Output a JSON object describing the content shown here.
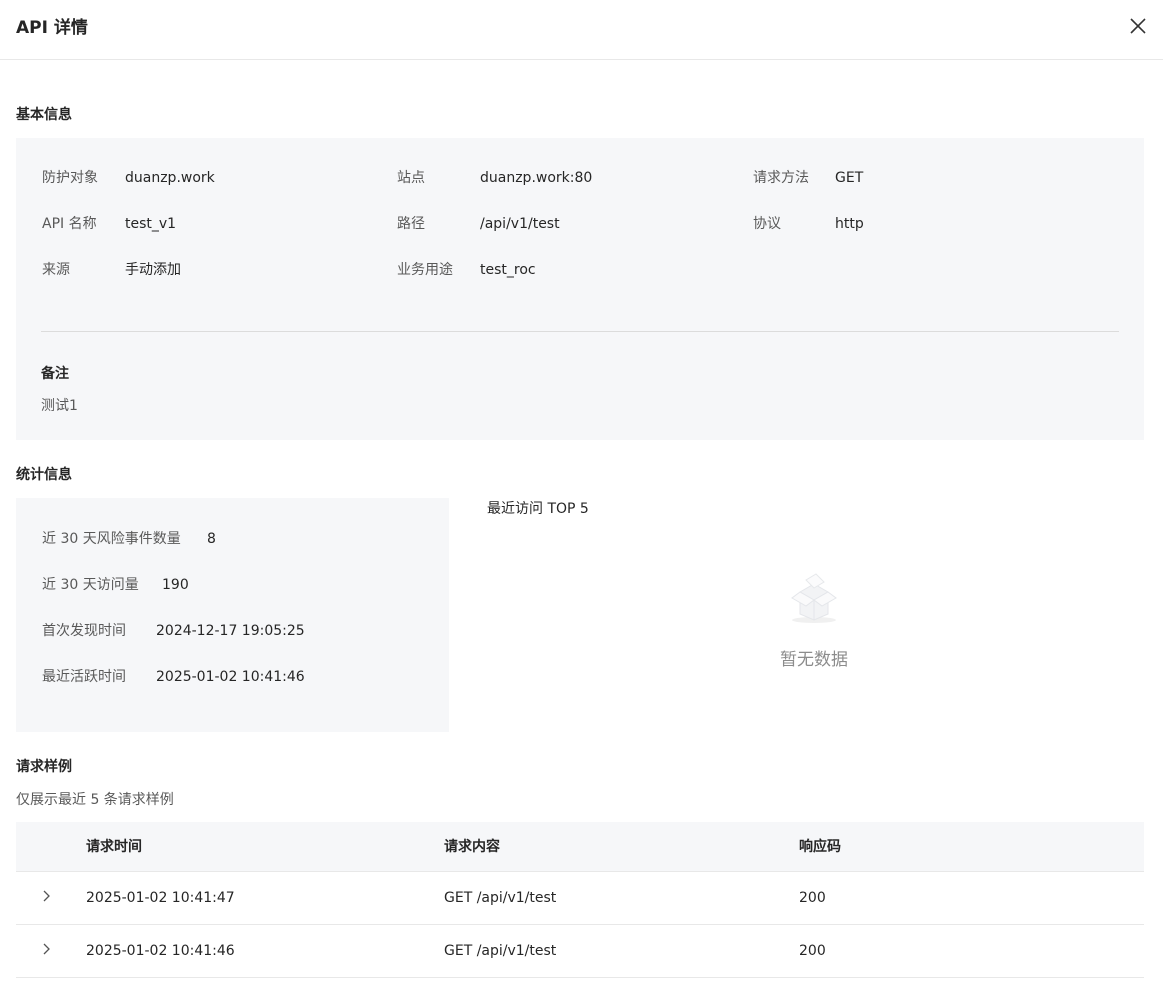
{
  "header": {
    "title": "API 详情",
    "close_icon": "close-icon"
  },
  "basic": {
    "section_title": "基本信息",
    "rows": [
      [
        {
          "label": "防护对象",
          "value": "duanzp.work"
        },
        {
          "label": "站点",
          "value": "duanzp.work:80"
        },
        {
          "label": "请求方法",
          "value": "GET"
        }
      ],
      [
        {
          "label": "API 名称",
          "value": "test_v1"
        },
        {
          "label": "路径",
          "value": "/api/v1/test"
        },
        {
          "label": "协议",
          "value": "http"
        }
      ],
      [
        {
          "label": "来源",
          "value": "手动添加"
        },
        {
          "label": "业务用途",
          "value": "test_roc"
        }
      ]
    ],
    "note_title": "备注",
    "note_text": "测试1"
  },
  "stats": {
    "section_title": "统计信息",
    "items": [
      {
        "label": "近 30 天风险事件数量",
        "value": "8"
      },
      {
        "label": "近 30 天访问量",
        "value": "190"
      },
      {
        "label": "首次发现时间",
        "value": "2024-12-17 19:05:25"
      },
      {
        "label": "最近活跃时间",
        "value": "2025-01-02 10:41:46"
      }
    ],
    "top5_title": "最近访问 TOP 5",
    "empty_icon": "empty-box-icon",
    "empty_text": "暂无数据"
  },
  "samples": {
    "section_title": "请求样例",
    "hint": "仅展示最近 5 条请求样例",
    "columns": [
      "请求时间",
      "请求内容",
      "响应码"
    ],
    "rows": [
      {
        "time": "2025-01-02 10:41:47",
        "content": "GET /api/v1/test",
        "code": "200"
      },
      {
        "time": "2025-01-02 10:41:46",
        "content": "GET /api/v1/test",
        "code": "200"
      }
    ],
    "expand_icon": "chevron-right-icon"
  }
}
